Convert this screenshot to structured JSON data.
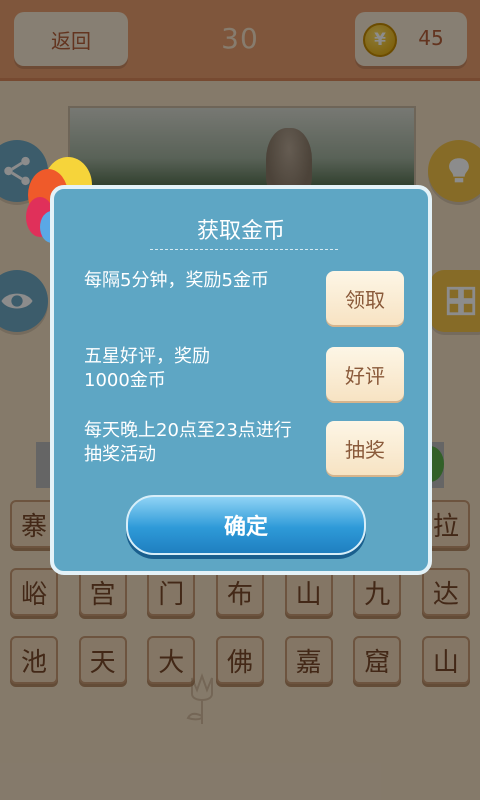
{
  "header": {
    "back_label": "返回",
    "level": "30",
    "coin_symbol": "¥",
    "coins": "45"
  },
  "tiles": [
    [
      "寨",
      "",
      "",
      "",
      "",
      "",
      "拉"
    ],
    [
      "峪",
      "宫",
      "门",
      "布",
      "山",
      "九",
      "达"
    ],
    [
      "池",
      "天",
      "大",
      "佛",
      "嘉",
      "窟",
      "山"
    ]
  ],
  "dialog": {
    "title": "获取金币",
    "rewards": [
      {
        "text": "每隔5分钟，奖励5金币",
        "button": "领取"
      },
      {
        "text": "五星好评，奖励1000金币",
        "button": "好评"
      },
      {
        "text": "每天晚上20点至23点进行抽奖活动",
        "button": "抽奖"
      }
    ],
    "confirm_label": "确定"
  },
  "colors": {
    "header_bg": "#e89d6e",
    "dialog_bg": "#5ea6c4",
    "confirm_blue": "#2e9ad8",
    "tile_bg": "#f0d8b8"
  },
  "icons": [
    "share-icon",
    "eye-icon",
    "hint-icon",
    "grid-icon",
    "coin-icon",
    "balloons-icon"
  ]
}
